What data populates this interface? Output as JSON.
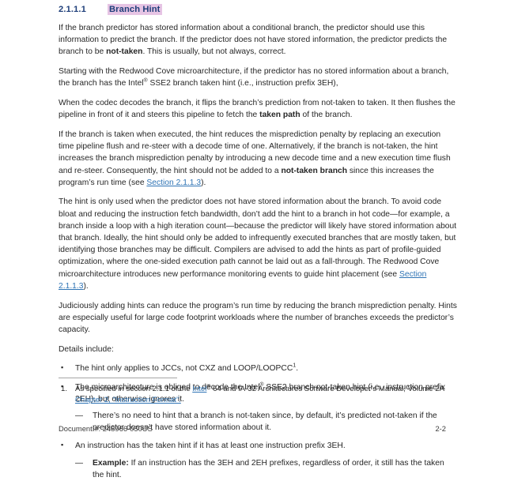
{
  "heading": {
    "number": "2.1.1.1",
    "title": "Branch Hint",
    "number_color": "#1f3f7a",
    "title_color": "#1f3f7a",
    "highlight_color": "#e6c4e4"
  },
  "link_color": "#2f74b5",
  "paragraphs": {
    "p1_a": "If the branch predictor has stored information about a conditional branch, the predictor should use this information to predict the branch. If the predictor does not have stored information, the predictor predicts the branch to be ",
    "p1_bold": "not-taken",
    "p1_b": ". This is usually, but not always, correct.",
    "p2_a": "Starting with the Redwood Cove microarchitecture, if the predictor has no stored information about a branch, the branch has the Intel",
    "p2_reg": "®",
    "p2_b": " SSE2 branch taken hint (i.e., instruction prefix 3EH),",
    "p3_a": "When the codec decodes the branch, it flips the branch’s prediction from not-taken to taken. It then flushes the pipeline in front of it and steers this pipeline to fetch the ",
    "p3_bold": "taken path",
    "p3_b": " of the branch.",
    "p4_a": "If the branch is taken when executed, the hint reduces the misprediction penalty by replacing an execution time pipeline flush and re-steer with a decode time of one. Alternatively, if the branch is not-taken, the hint increases the branch misprediction penalty by introducing a new decode time and a new execution time flush and re-steer. Consequently, the hint should not be added to a ",
    "p4_bold": "not-taken branch",
    "p4_b": " since this increases the program’s run time (see ",
    "p4_link": "Section 2.1.1.3",
    "p4_c": ").",
    "p5_a": "The hint is only used when the predictor does not have stored information about the branch. To avoid  code bloat and reducing the instruction fetch bandwidth, don’t add the hint to a branch in hot code—for example, a branch inside a loop with a high iteration count—because the predictor will likely have stored information about that branch. Ideally, the hint should only be added to infrequently executed branches that are mostly taken, but identifying those branches may be difficult. Compilers are advised to add the hints as part of profile-guided optimization, where the one-sided execution path cannot be laid out as a fall-through. The Redwood Cove microarchitecture introduces new performance monitoring events to guide hint placement (see ",
    "p5_link": "Section 2.1.1.3",
    "p5_b": ").",
    "p6": "Judiciously adding hints can reduce the program’s run time by reducing the branch misprediction penalty. Hints are especially useful for large code footprint workloads where the number of branches exceeds the predictor’s capacity.",
    "p7": "Details include:"
  },
  "bullets": {
    "marker_level1": "▪",
    "marker_level2": "—",
    "item1_a": "The hint only applies to JCCs, not CXZ and LOOP/LOOPCC",
    "item1_sup": "1",
    "item1_b": ".",
    "item2_a": "The microarchitecture is obliged to decode the Intel",
    "item2_reg": "®",
    "item2_b": " SSE2 branch not-taken hint (i.e., instruction prefix 2EH), but otherwise ignores it.",
    "item2_sub1": "There’s no need to hint that a branch is not-taken since, by default, it’s predicted not-taken if the predictor doesn’t have stored information about it.",
    "item3": "An instruction has the taken hint if it has at least one instruction prefix 3EH.",
    "item3_sub1_bold": "Example:",
    "item3_sub1_text": " If an instruction has the 3EH and 2EH prefixes, regardless of order, it still has the taken the hint."
  },
  "footnote": {
    "number": "1.",
    "text_a": "As specified in section 2.1.1 of the ",
    "link1": "Intel",
    "reg": "®",
    "text_b": " 64 and IA-32 Architectures Software Developer’s Manual, Volume 2A",
    "link2": "Chapter 2, “Instruction Format”."
  },
  "footer": {
    "document_id": "Document #: 248966-050US",
    "page_number": "2-2"
  }
}
